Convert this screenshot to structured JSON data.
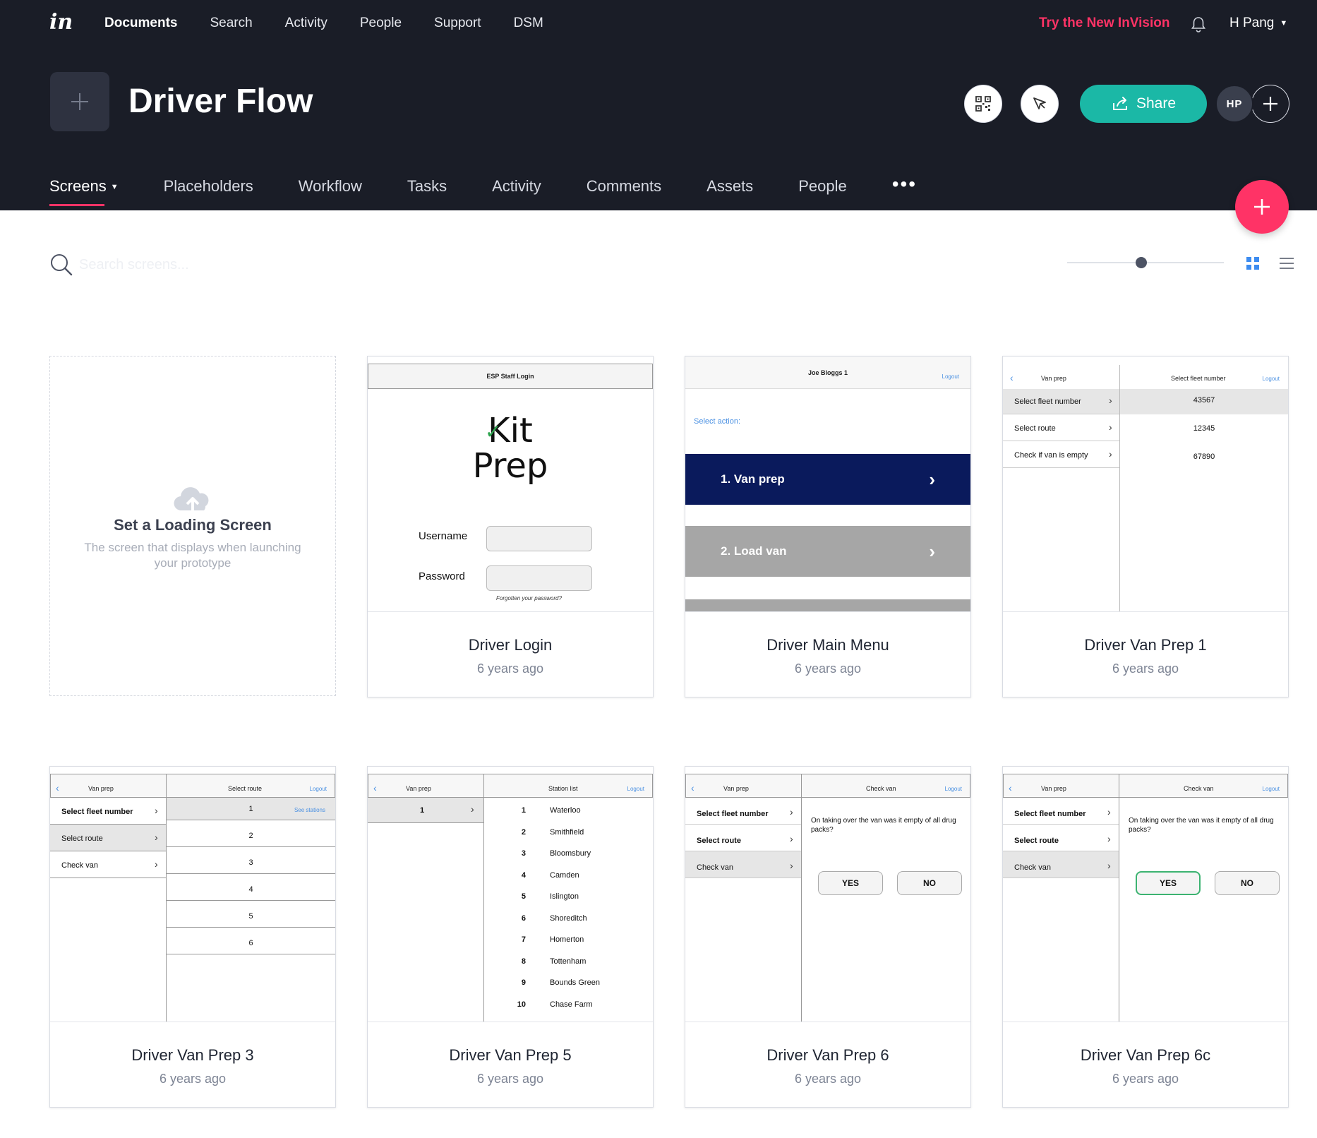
{
  "topnav": {
    "logo": "in",
    "items": [
      "Documents",
      "Search",
      "Activity",
      "People",
      "Support",
      "DSM"
    ],
    "try_new": "Try the New InVision",
    "user": "H Pang"
  },
  "project": {
    "title": "Driver Flow",
    "share_label": "Share",
    "avatar_initials": "HP"
  },
  "subnav": {
    "tabs": [
      "Screens",
      "Placeholders",
      "Workflow",
      "Tasks",
      "Activity",
      "Comments",
      "Assets",
      "People"
    ],
    "more": "•••"
  },
  "toolbar": {
    "search_placeholder": "Search screens...",
    "zoom_level": 0.47
  },
  "loading": {
    "title": "Set a Loading Screen",
    "desc": "The screen that displays when launching your prototype"
  },
  "cards": [
    {
      "name": "Driver Login",
      "age": "6 years ago"
    },
    {
      "name": "Driver Main Menu",
      "age": "6 years ago"
    },
    {
      "name": "Driver Van Prep 1",
      "age": "6 years ago"
    },
    {
      "name": "Driver Van Prep 3",
      "age": "6 years ago"
    },
    {
      "name": "Driver Van Prep 5",
      "age": "6 years ago"
    },
    {
      "name": "Driver Van Prep 6",
      "age": "6 years ago"
    },
    {
      "name": "Driver Van Prep 6c",
      "age": "6 years ago"
    }
  ],
  "mock": {
    "login": {
      "header": "ESP Staff Login",
      "logo_line1": "Kit",
      "logo_line2": "Prep",
      "username": "Username",
      "password": "Password",
      "forgot": "Forgotten your password?"
    },
    "menu": {
      "header": "Joe Bloggs 1",
      "logout": "Logout",
      "select_action": "Select action:",
      "item1": "1. Van prep",
      "item2": "2. Load van"
    },
    "vp1": {
      "left_title": "Van prep",
      "right_title": "Select fleet number",
      "logout": "Logout",
      "left_items": [
        "Select fleet number",
        "Select route",
        "Check if van is empty"
      ],
      "fleet": [
        "43567",
        "12345",
        "67890"
      ]
    },
    "vp3": {
      "left_title": "Van prep",
      "right_title": "Select route",
      "logout": "Logout",
      "left_items": [
        "Select fleet number",
        "Select route",
        "Check van"
      ],
      "routes": [
        "1",
        "2",
        "3",
        "4",
        "5",
        "6"
      ],
      "see_stations": "See stations"
    },
    "vp5": {
      "left_title": "Van prep",
      "right_title": "Station list",
      "logout": "Logout",
      "left_value": "1",
      "stations": [
        {
          "n": "1",
          "s": "Waterloo"
        },
        {
          "n": "2",
          "s": "Smithfield"
        },
        {
          "n": "3",
          "s": "Bloomsbury"
        },
        {
          "n": "4",
          "s": "Camden"
        },
        {
          "n": "5",
          "s": "Islington"
        },
        {
          "n": "6",
          "s": "Shoreditch"
        },
        {
          "n": "7",
          "s": "Homerton"
        },
        {
          "n": "8",
          "s": "Tottenham"
        },
        {
          "n": "9",
          "s": "Bounds Green"
        },
        {
          "n": "10",
          "s": "Chase Farm"
        }
      ]
    },
    "vp6": {
      "left_title": "Van prep",
      "right_title": "Check van",
      "logout": "Logout",
      "left_items": [
        "Select fleet number",
        "Select route",
        "Check van"
      ],
      "question": "On taking over the van was it empty of all drug packs?",
      "yes": "YES",
      "no": "NO"
    }
  }
}
